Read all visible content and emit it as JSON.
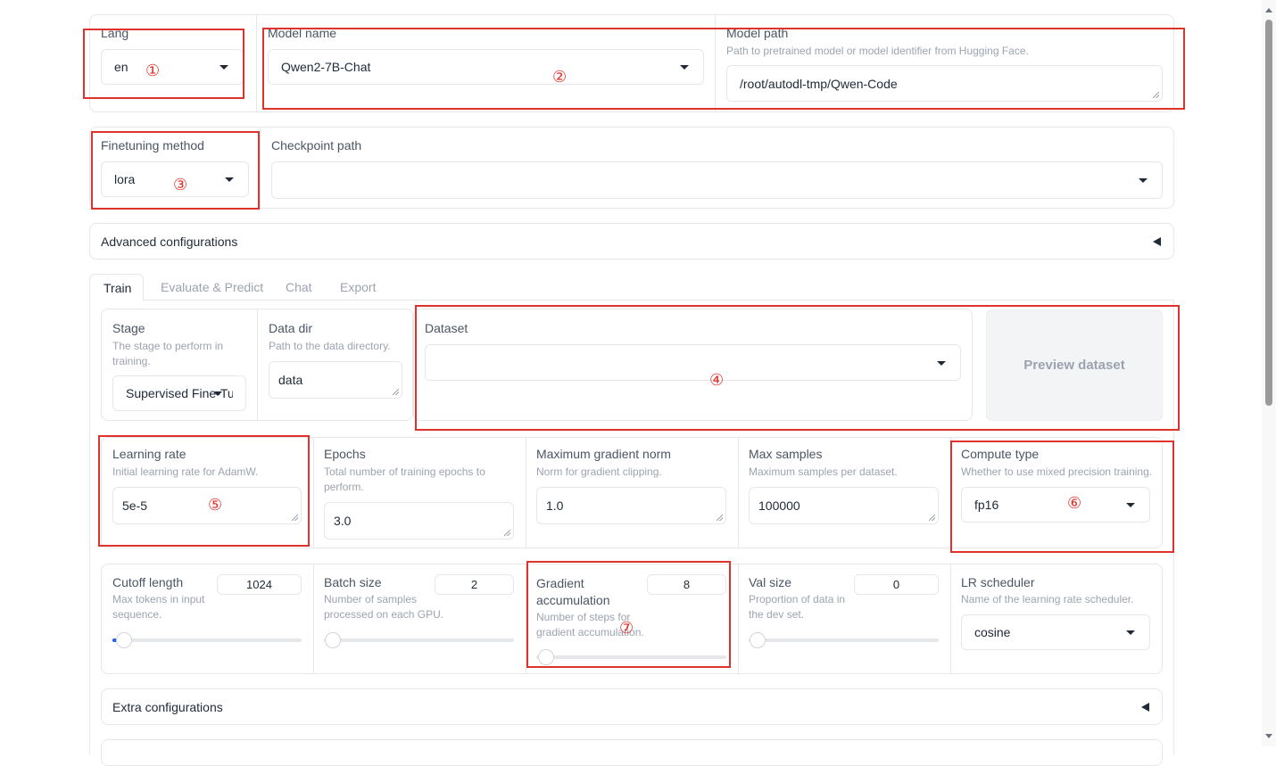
{
  "top": {
    "lang": {
      "label": "Lang",
      "value": "en"
    },
    "model_name": {
      "label": "Model name",
      "value": "Qwen2-7B-Chat"
    },
    "model_path": {
      "label": "Model path",
      "info": "Path to pretrained model or model identifier from Hugging Face.",
      "value": "/root/autodl-tmp/Qwen-Code"
    }
  },
  "finetune": {
    "method": {
      "label": "Finetuning method",
      "value": "lora"
    },
    "checkpoint": {
      "label": "Checkpoint path",
      "value": ""
    }
  },
  "advanced": {
    "label": "Advanced configurations"
  },
  "tabs": [
    {
      "label": "Train",
      "active": true
    },
    {
      "label": "Evaluate & Predict",
      "active": false
    },
    {
      "label": "Chat",
      "active": false
    },
    {
      "label": "Export",
      "active": false
    }
  ],
  "train": {
    "stage": {
      "label": "Stage",
      "info": "The stage to perform in training.",
      "value": "Supervised Fine-Tur"
    },
    "data_dir": {
      "label": "Data dir",
      "info": "Path to the data directory.",
      "value": "data"
    },
    "dataset": {
      "label": "Dataset",
      "value": ""
    },
    "preview_button": "Preview dataset",
    "learning_rate": {
      "label": "Learning rate",
      "info": "Initial learning rate for AdamW.",
      "value": "5e-5"
    },
    "epochs": {
      "label": "Epochs",
      "info": "Total number of training epochs to perform.",
      "value": "3.0"
    },
    "max_grad_norm": {
      "label": "Maximum gradient norm",
      "info": "Norm for gradient clipping.",
      "value": "1.0"
    },
    "max_samples": {
      "label": "Max samples",
      "info": "Maximum samples per dataset.",
      "value": "100000"
    },
    "compute_type": {
      "label": "Compute type",
      "info": "Whether to use mixed precision training.",
      "value": "fp16"
    },
    "cutoff_len": {
      "label": "Cutoff length",
      "info": "Max tokens in input sequence.",
      "value": "1024",
      "fraction": 0.05
    },
    "batch_size": {
      "label": "Batch size",
      "info": "Number of samples processed on each GPU.",
      "value": "2",
      "fraction": 0.0
    },
    "grad_accum": {
      "label": "Gradient accumulation",
      "info": "Number of steps for gradient accumulation.",
      "value": "8",
      "fraction": 0.03
    },
    "val_size": {
      "label": "Val size",
      "info": "Proportion of data in the dev set.",
      "value": "0",
      "fraction": 0.0
    },
    "lr_scheduler": {
      "label": "LR scheduler",
      "info": "Name of the learning rate scheduler.",
      "value": "cosine"
    },
    "extra": {
      "label": "Extra configurations"
    }
  },
  "annotations": [
    "①",
    "②",
    "③",
    "④",
    "⑤",
    "⑥",
    "⑦"
  ],
  "colors": {
    "annotation": "#e0322c",
    "border": "#e5e7eb",
    "accent": "#2563eb"
  }
}
